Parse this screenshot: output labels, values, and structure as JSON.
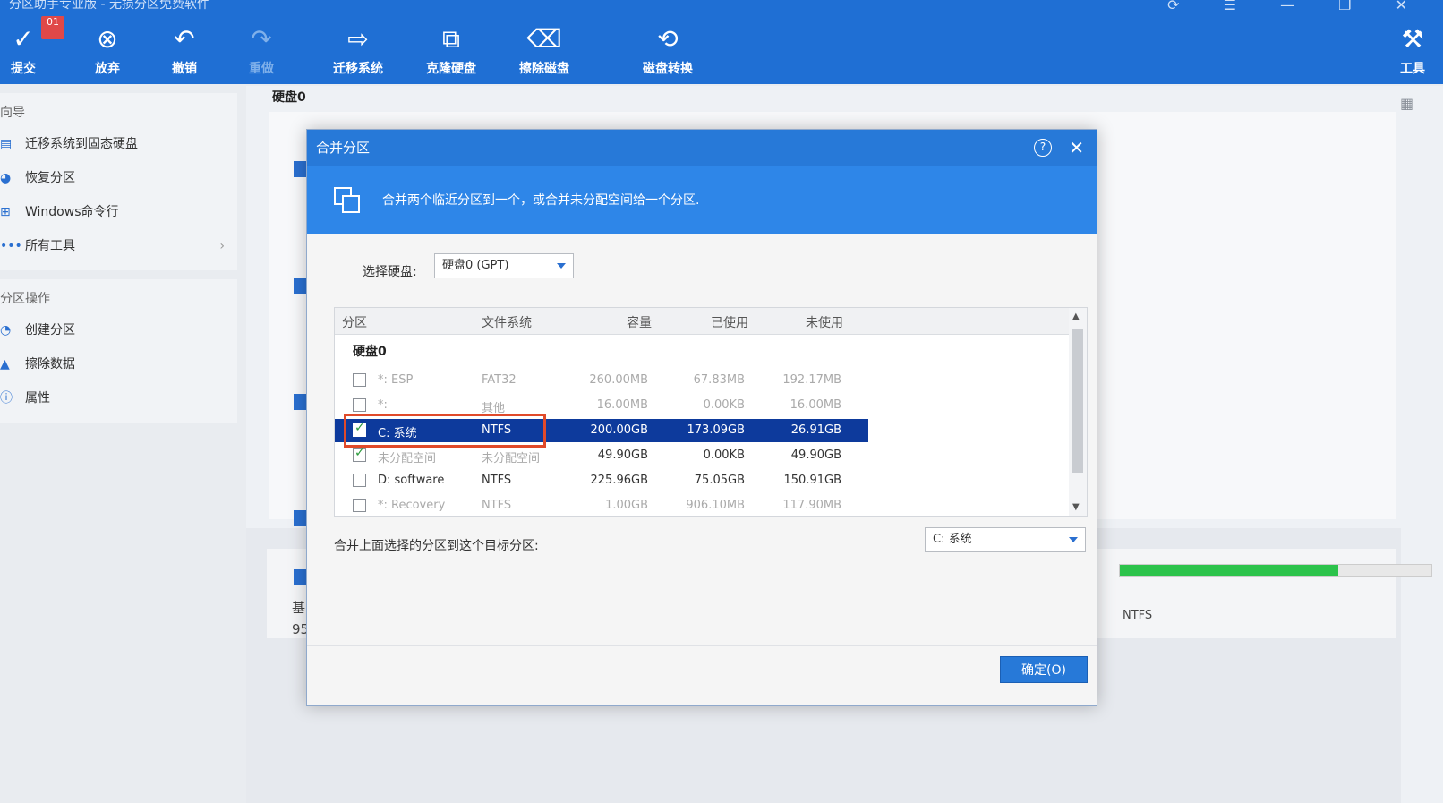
{
  "toolbar": {
    "title_fragment": "分区助手专业版 - 无损分区免费软件",
    "badge": "01",
    "buttons": [
      {
        "label": "提交",
        "icon": "check-icon"
      },
      {
        "label": "放弃",
        "icon": "cancel-icon"
      },
      {
        "label": "撤销",
        "icon": "undo-icon"
      },
      {
        "label": "重做",
        "icon": "redo-icon"
      },
      {
        "label": "迁移系统",
        "icon": "migrate-icon"
      },
      {
        "label": "克隆硬盘",
        "icon": "clone-icon"
      },
      {
        "label": "擦除磁盘",
        "icon": "wipe-icon"
      },
      {
        "label": "磁盘转换",
        "icon": "convert-icon"
      },
      {
        "label": "工具",
        "icon": "tools-icon"
      }
    ]
  },
  "sidebar": {
    "wizard_head": "向导",
    "wizard_items": [
      "迁移系统到固态硬盘",
      "恢复分区",
      "Windows命令行",
      "所有工具"
    ],
    "ops_head": "分区操作",
    "ops_items": [
      "创建分区",
      "擦除数据",
      "属性"
    ]
  },
  "main": {
    "disk_label": "硬盘0",
    "lower_text_1": "基",
    "lower_text_2": "95",
    "ntfs_right": "NTFS",
    "usage_fraction": 0.7
  },
  "dialog": {
    "title": "合并分区",
    "help": "?",
    "close": "✕",
    "banner": "合并两个临近分区到一个，或合并未分配空间给一个分区.",
    "select_disk_label": "选择硬盘:",
    "select_disk_value": "硬盘0 (GPT)",
    "columns": [
      "分区",
      "文件系统",
      "容量",
      "已使用",
      "未使用"
    ],
    "group": "硬盘0",
    "rows": [
      {
        "name": "*: ESP",
        "fs": "FAT32",
        "cap": "260.00MB",
        "used": "67.83MB",
        "free": "192.17MB"
      },
      {
        "name": "*:",
        "fs": "其他",
        "cap": "16.00MB",
        "used": "0.00KB",
        "free": "16.00MB"
      },
      {
        "name": "C: 系统",
        "fs": "NTFS",
        "cap": "200.00GB",
        "used": "173.09GB",
        "free": "26.91GB"
      },
      {
        "name": "未分配空间",
        "fs": "未分配空间",
        "cap": "49.90GB",
        "used": "0.00KB",
        "free": "49.90GB"
      },
      {
        "name": "D: software",
        "fs": "NTFS",
        "cap": "225.96GB",
        "used": "75.05GB",
        "free": "150.91GB"
      },
      {
        "name": "*: Recovery",
        "fs": "NTFS",
        "cap": "1.00GB",
        "used": "906.10MB",
        "free": "117.90MB"
      }
    ],
    "merge_label": "合并上面选择的分区到这个目标分区:",
    "target_value": "C: 系统",
    "ok": "确定(O)"
  }
}
